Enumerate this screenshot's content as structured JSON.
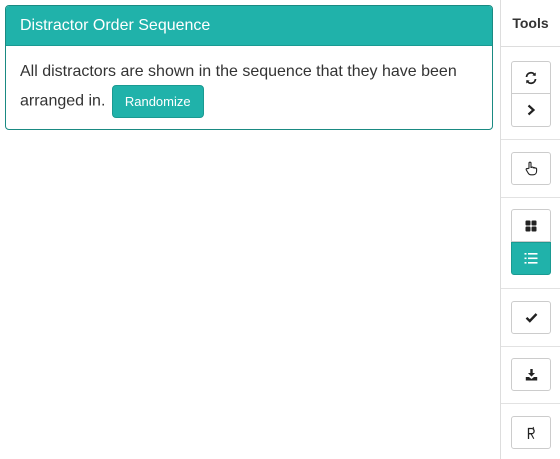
{
  "panel": {
    "title": "Distractor Order Sequence",
    "description": "All distractors are shown in the sequence that they have been arranged in.",
    "randomize_label": "Randomize"
  },
  "tools": {
    "title": "Tools",
    "buttons": [
      {
        "name": "refresh",
        "icon": "refresh-icon"
      },
      {
        "name": "next",
        "icon": "chevron-right-icon"
      },
      {
        "name": "pointer",
        "icon": "hand-pointer-icon"
      },
      {
        "name": "grid-view",
        "icon": "grid-icon"
      },
      {
        "name": "list-view",
        "icon": "ordered-list-icon",
        "active": true
      },
      {
        "name": "check",
        "icon": "checkmark-icon"
      },
      {
        "name": "download",
        "icon": "download-icon"
      },
      {
        "name": "p-notation",
        "icon": "p-notation-icon"
      }
    ]
  },
  "colors": {
    "accent": "#20b2aa",
    "accent_border": "#1a8a82"
  }
}
